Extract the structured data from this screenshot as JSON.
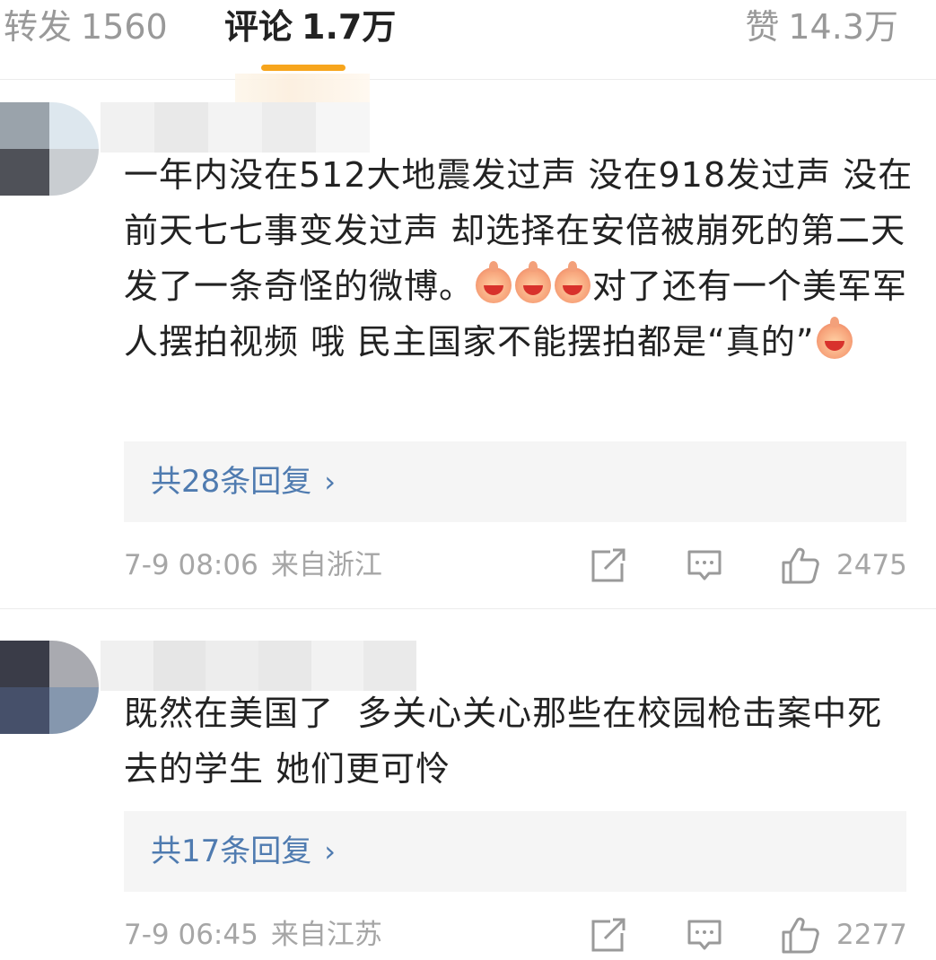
{
  "tabs": {
    "reposts": {
      "label": "转发",
      "count": "1560"
    },
    "comments": {
      "label": "评论",
      "count": "1.7万"
    },
    "likes": {
      "label": "赞",
      "count": "14.3万"
    }
  },
  "colors": {
    "accent_underline": "#f7a51c",
    "reply_link": "#4f7bb0",
    "meta_text": "#a6a6a6"
  },
  "comments": [
    {
      "text_parts": [
        "一年内没在512大地震发过声 没在918发过声 没在前天七七事变发过声 却选择在安倍被崩死的第二天发了一条奇怪的微博。",
        "对了还有一个美军军人摆拍视频 哦 民主国家不能摆拍都是“真的”"
      ],
      "emoji_after_part_1": 3,
      "emoji_after_part_2": 1,
      "emoji_icon": "laughing-emoji-icon",
      "replies_label": "共28条回复",
      "time": "7-9 08:06",
      "location": "来自浙江",
      "like_count": "2475"
    },
    {
      "text_parts": [
        "既然在美国了  多关心关心那些在校园枪击案中死去的学生 她们更可怜"
      ],
      "replies_label": "共17条回复",
      "time": "7-9 06:45",
      "location": "来自江苏",
      "like_count": "2277"
    }
  ],
  "icons": {
    "share": "share-icon",
    "comment": "comment-icon",
    "like": "thumbs-up-icon",
    "chevron": "chevron-right-icon"
  }
}
